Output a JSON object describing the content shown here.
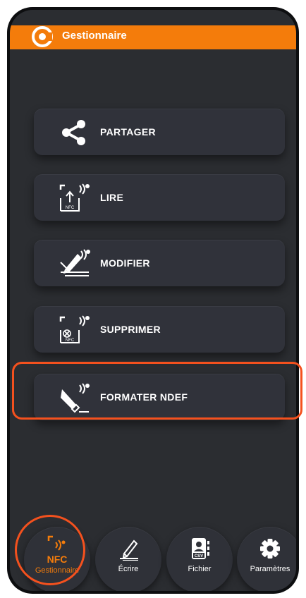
{
  "appbar": {
    "title": "Gestionnaire"
  },
  "menu": [
    {
      "label": "PARTAGER",
      "icon": "share-icon"
    },
    {
      "label": "LIRE",
      "icon": "nfc-read-icon"
    },
    {
      "label": "MODIFIER",
      "icon": "edit-pen-icon"
    },
    {
      "label": "SUPPRIMER",
      "icon": "nfc-delete-icon"
    },
    {
      "label": "FORMATER NDEF",
      "icon": "format-ndef-icon",
      "highlighted": true
    }
  ],
  "bottom_nav": [
    {
      "label": "Gestionnaire",
      "badge": "NFC",
      "icon": "nfc-icon",
      "active": true
    },
    {
      "label": "Écrire",
      "icon": "write-icon"
    },
    {
      "label": "Fichier",
      "icon": "csv-file-icon"
    },
    {
      "label": "Paramètres",
      "icon": "gear-icon"
    }
  ],
  "icon_small_text": {
    "nfc": "NFC",
    "csv": "CSV"
  },
  "colors": {
    "accent": "#f47c0b",
    "highlight": "#f4511e",
    "background": "#2b2d31",
    "button": "#30323a"
  }
}
